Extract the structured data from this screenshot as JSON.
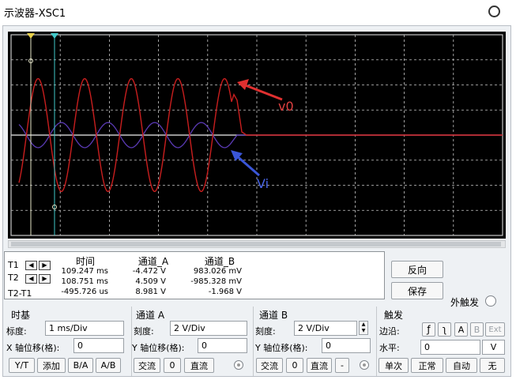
{
  "window": {
    "title": "示波器-XSC1"
  },
  "annotations": {
    "v0_label": "v0",
    "vi_label": "Vi"
  },
  "colors": {
    "screen_bg": "#000000",
    "grid": "#c8c8c8",
    "channel_a": "#c81e1e",
    "channel_b": "#5a3ab4",
    "t1_cursor": "#e6e6c8",
    "t2_cursor": "#40c8c8",
    "arrow_red": "#e03030",
    "arrow_blue": "#3a56d8"
  },
  "cursors": {
    "row_labels": [
      "T1",
      "T2",
      "T2-T1"
    ],
    "headers": {
      "time": "时间",
      "channel_a": "通道_A",
      "channel_b": "通道_B"
    },
    "rows": [
      {
        "time": "109.247 ms",
        "a": "-4.472 V",
        "b": "983.026 mV"
      },
      {
        "time": "108.751 ms",
        "a": "4.509 V",
        "b": "-985.328 mV"
      },
      {
        "time": "-495.726 us",
        "a": "8.981 V",
        "b": "-1.968 V"
      }
    ]
  },
  "buttons": {
    "reverse": "反向",
    "save": "保存"
  },
  "ext_trigger": {
    "label": "外触发"
  },
  "timebase": {
    "title": "时基",
    "scale_label": "标度:",
    "scale_value": "1 ms/Div",
    "xpos_label": "X 轴位移(格):",
    "xpos_value": "0",
    "modes": [
      "Y/T",
      "添加",
      "B/A",
      "A/B"
    ]
  },
  "channel_a": {
    "title": "通道 A",
    "scale_label": "刻度:",
    "scale_value": "2  V/Div",
    "ypos_label": "Y 轴位移(格):",
    "ypos_value": "0",
    "coupling": [
      "交流",
      "0",
      "直流"
    ]
  },
  "channel_b": {
    "title": "通道 B",
    "scale_label": "刻度:",
    "scale_value": "2  V/Div",
    "ypos_label": "Y 轴位移(格):",
    "ypos_value": "0",
    "coupling": [
      "交流",
      "0",
      "直流",
      "-"
    ]
  },
  "trigger": {
    "title": "触发",
    "edge_label": "边沿:",
    "edge_buttons": [
      "ƒ",
      "ʅ",
      "A",
      "B",
      "Ext"
    ],
    "level_label": "水平:",
    "level_value": "0",
    "level_unit": "V",
    "modes": [
      "单次",
      "正常",
      "自动",
      "无"
    ]
  }
}
